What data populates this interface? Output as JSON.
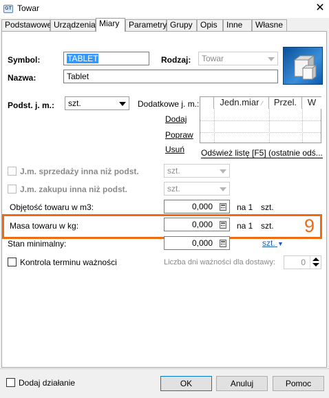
{
  "window": {
    "title": "Towar",
    "app_icon_text": "GT"
  },
  "tabs": [
    {
      "label": "Podstawowe",
      "active": false
    },
    {
      "label": "Urządzenia",
      "active": false
    },
    {
      "label": "Miary",
      "active": true
    },
    {
      "label": "Parametry",
      "active": false
    },
    {
      "label": "Grupy",
      "active": false
    },
    {
      "label": "Opis",
      "active": false
    },
    {
      "label": "Inne",
      "active": false
    },
    {
      "label": "Własne",
      "active": false
    }
  ],
  "form": {
    "symbol_label": "Symbol:",
    "symbol_value": "TABLET",
    "rodzaj_label": "Rodzaj:",
    "rodzaj_value": "Towar",
    "nazwa_label": "Nazwa:",
    "nazwa_value": "Tablet",
    "podst_jm_label": "Podst. j. m.:",
    "podst_jm_value": "szt.",
    "dodatkowe_label": "Dodatkowe j. m.:",
    "units_table": {
      "columns": [
        "Jedn.miar",
        "Przel.",
        "W"
      ],
      "rows": []
    },
    "dodaj_link": "Dodaj",
    "popraw_link": "Popraw",
    "usun_link": "Usuń",
    "odswiez_link": "Odśwież listę [F5] (ostatnie odś...",
    "jm_sprzedazy_label": "J.m. sprzedaży inna niż podst.",
    "jm_sprzedazy_value": "szt.",
    "jm_zakupu_label": "J.m. zakupu inna niż podst.",
    "jm_zakupu_value": "szt.",
    "objetosc_label": "Objętość towaru w m3:",
    "objetosc_value": "0,000",
    "objetosc_unit_na": "na 1",
    "objetosc_unit": "szt.",
    "masa_label": "Masa towaru w kg:",
    "masa_value": "0,000",
    "masa_unit_na": "na 1",
    "masa_unit": "szt.",
    "stan_min_label": "Stan minimalny:",
    "stan_min_value": "0,000",
    "stan_min_unit": "szt.",
    "kontrola_label": "Kontrola terminu ważności",
    "liczba_dni_label": "Liczba dni ważności dla dostawy:",
    "liczba_dni_value": "0"
  },
  "annotation": {
    "number": "9",
    "color": "#f26a10"
  },
  "footer": {
    "dodaj_dzialanie_label": "Dodaj działanie",
    "ok_label": "OK",
    "anuluj_label": "Anuluj",
    "pomoc_label": "Pomoc"
  },
  "colors": {
    "accent_link": "#1a5fb4",
    "selection": "#3399ff"
  }
}
